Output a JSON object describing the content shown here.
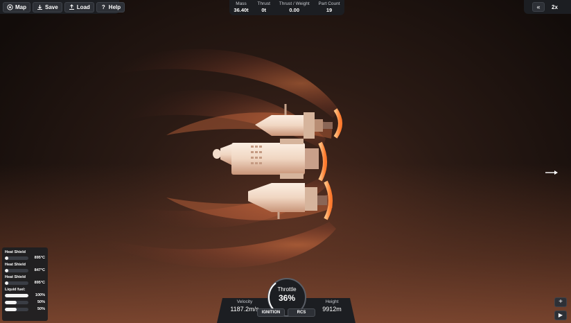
{
  "toolbar": {
    "buttons": [
      {
        "label": "Map",
        "icon": "map-icon"
      },
      {
        "label": "Save",
        "icon": "download-icon"
      },
      {
        "label": "Load",
        "icon": "upload-icon"
      },
      {
        "label": "Help",
        "icon": "question-icon"
      }
    ]
  },
  "stats": {
    "mass_label": "Mass",
    "mass_value": "36.40t",
    "thrust_label": "Thrust",
    "thrust_value": "0t",
    "tw_label": "Thrust / Weight",
    "tw_value": "0.00",
    "parts_label": "Part Count",
    "parts_value": "19"
  },
  "timewarp": {
    "rewind_icon": "double-chevron-left-icon",
    "rewind_glyph": "«",
    "speed": "2x"
  },
  "parts_panel": {
    "items": [
      {
        "name": "Heat Shield",
        "value": "895°C",
        "fill": 0.15
      },
      {
        "name": "Heat Shield",
        "value": "847°C",
        "fill": 0.15
      },
      {
        "name": "Heat Shield",
        "value": "895°C",
        "fill": 0.15
      }
    ],
    "fuel_label": "Liquid fuel:",
    "fuel": [
      {
        "value": "100%",
        "fill": 1.0
      },
      {
        "value": "50%",
        "fill": 0.5
      },
      {
        "value": "50%",
        "fill": 0.5
      }
    ]
  },
  "flight": {
    "velocity_label": "Velocity",
    "velocity_value": "1187.2m/s",
    "throttle_label": "Throttle",
    "throttle_value": "36%",
    "throttle_level": 0.36,
    "height_label": "Height",
    "height_value": "9912m",
    "ignition_label": "IGNITION",
    "rcs_label": "RCS"
  },
  "bottom_right": {
    "zoom_glyph": "+",
    "play_glyph": "▶"
  },
  "colors": {
    "panel": "#1c1e22",
    "plasma": "#f27a3c",
    "hull": "#f1dccb"
  }
}
